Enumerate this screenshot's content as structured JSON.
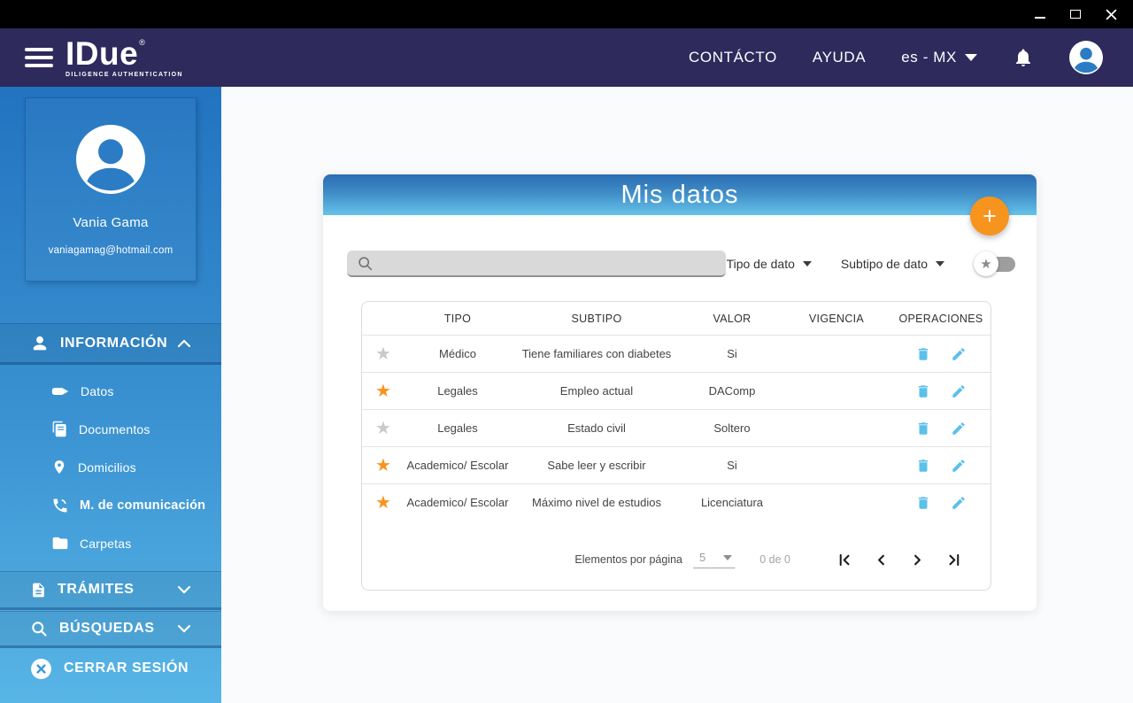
{
  "header": {
    "brand": "IDue",
    "brand_mark": "®",
    "tagline": "DILIGENCE AUTHENTICATION",
    "nav": {
      "contacto": "CONTÁCTO",
      "ayuda": "AYUDA",
      "locale": "es - MX"
    }
  },
  "sidebar": {
    "profile": {
      "name": "Vania Gama",
      "email": "vaniagamag@hotmail.com"
    },
    "informacion": {
      "label": "INFORMACIÓN",
      "items": [
        {
          "label": "Datos",
          "icon": "card-icon",
          "active": false
        },
        {
          "label": "Documentos",
          "icon": "documents-icon",
          "active": false
        },
        {
          "label": "Domicilios",
          "icon": "map-pin-icon",
          "active": false
        },
        {
          "label": "M. de comunicación",
          "icon": "phone-icon",
          "active": true
        },
        {
          "label": "Carpetas",
          "icon": "folder-icon",
          "active": false
        }
      ]
    },
    "tramites": {
      "label": "TRÁMITES"
    },
    "busquedas": {
      "label": "BÚSQUEDAS"
    },
    "cerrar": {
      "label": "CERRAR SESIÓN"
    }
  },
  "main": {
    "title": "Mis datos",
    "add_button": "+",
    "filters": {
      "tipo": "Tipo de dato",
      "subtipo": "Subtipo de dato"
    },
    "table": {
      "columns": [
        "TIPO",
        "SUBTIPO",
        "VALOR",
        "VIGENCIA",
        "OPERACIONES"
      ],
      "rows": [
        {
          "favorite": false,
          "tipo": "Médico",
          "subtipo": "Tiene familiares con diabetes",
          "valor": "Si",
          "vigencia": ""
        },
        {
          "favorite": true,
          "tipo": "Legales",
          "subtipo": "Empleo actual",
          "valor": "DAComp",
          "vigencia": ""
        },
        {
          "favorite": false,
          "tipo": "Legales",
          "subtipo": "Estado civil",
          "valor": "Soltero",
          "vigencia": ""
        },
        {
          "favorite": true,
          "tipo": "Academico/ Escolar",
          "subtipo": "Sabe leer y escribir",
          "valor": "Si",
          "vigencia": ""
        },
        {
          "favorite": true,
          "tipo": "Academico/ Escolar",
          "subtipo": "Máximo nivel de estudios",
          "valor": "Licenciatura",
          "vigencia": ""
        }
      ]
    },
    "pagination": {
      "label": "Elementos por página",
      "page_size": "5",
      "range": "0 de 0"
    }
  },
  "icons": {
    "star": "★"
  },
  "colors": {
    "accent_orange": "#f7941e",
    "action_blue": "#5bc0ea",
    "navy": "#2e2a5c",
    "sidebar_top": "#2273c0",
    "sidebar_bottom": "#58b5e6",
    "star_inactive": "#c9c9c9"
  }
}
